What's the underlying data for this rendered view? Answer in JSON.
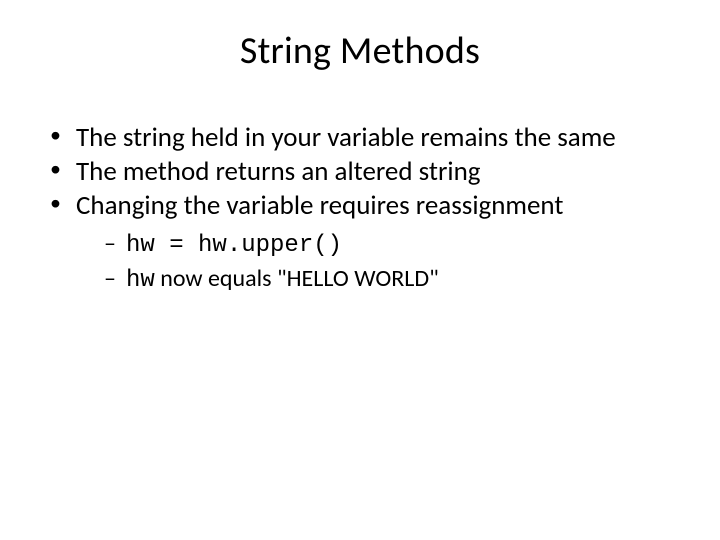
{
  "title": "String Methods",
  "bullets": {
    "b1": "The string held in your variable remains the same",
    "b2": "The method returns an altered string",
    "b3": "Changing the variable requires reassignment"
  },
  "sub": {
    "s1_code": "hw = hw.upper()",
    "s2_code": "hw",
    "s2_rest": " now equals \"HELLO WORLD\""
  }
}
